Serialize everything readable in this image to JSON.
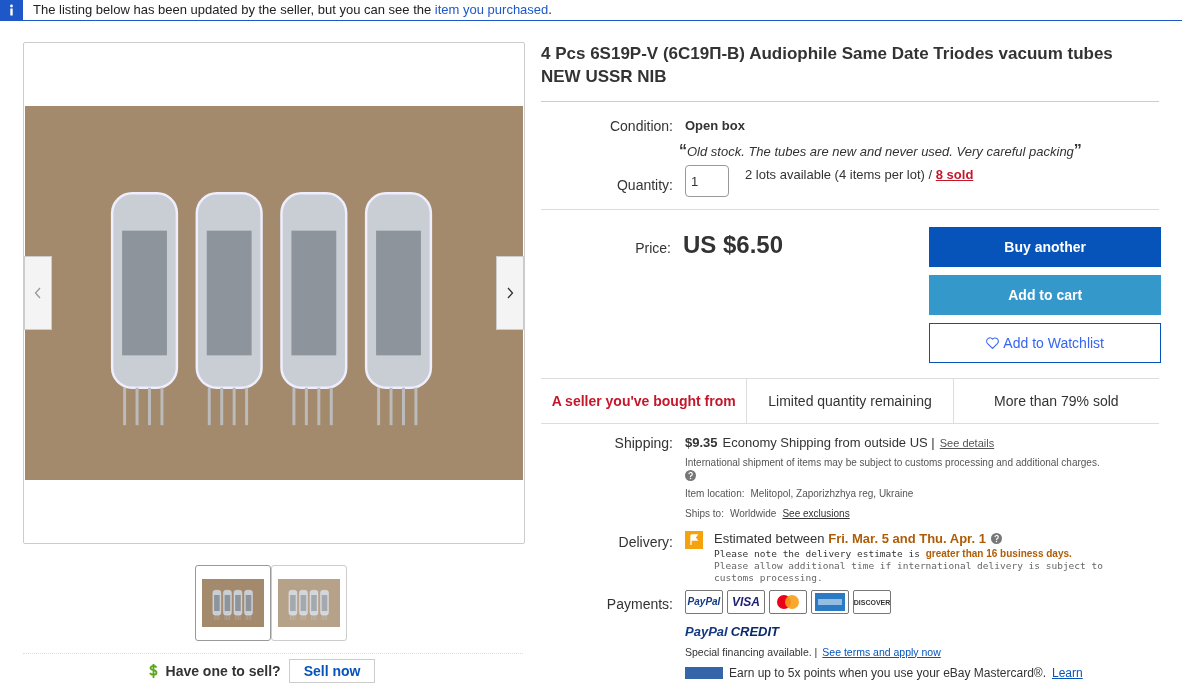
{
  "notice": {
    "text": "The listing below has been updated by the seller, but you can see the",
    "link": "item you purchased",
    "end": "."
  },
  "gallery": {
    "thumbnails": [
      {
        "selected": true
      },
      {
        "selected": false
      }
    ]
  },
  "sell": {
    "text": "Have one to sell?",
    "button": "Sell now"
  },
  "title": "4 Pcs 6S19P-V (6С19П-В) Audiophile Same Date Triodes vacuum tubes NEW USSR NIB",
  "condition": {
    "label": "Condition:",
    "value": "Open box",
    "open_quote": "“",
    "note": "Old stock. The tubes are new and never used. Very careful packing",
    "close_quote": "”"
  },
  "quantity": {
    "label": "Quantity:",
    "value": "1",
    "available": "2 lots available (4 items per lot) /",
    "sold": "8 sold"
  },
  "price": {
    "label": "Price:",
    "value": "US $6.50"
  },
  "buttons": [
    {
      "kind": "primary",
      "label": "Buy another"
    },
    {
      "kind": "secondary",
      "label": "Add to cart"
    },
    {
      "kind": "watch",
      "label": "Add to Watchlist"
    }
  ],
  "highlights": [
    {
      "text": "A seller you've bought from",
      "alert": true
    },
    {
      "text": "Limited quantity remaining",
      "alert": false
    },
    {
      "text": "More than 79% sold",
      "alert": false
    }
  ],
  "shipping": {
    "label": "Shipping:",
    "cost": "$9.35",
    "method": "Economy Shipping from outside US |",
    "details": "See details",
    "note": "International shipment of items may be subject to customs processing and additional charges.",
    "location_label": "Item location:",
    "location": "Melitopol, Zaporizhzhya reg, Ukraine",
    "ships_label": "Ships to:",
    "ships": "Worldwide",
    "exclusions": "See exclusions"
  },
  "delivery": {
    "label": "Delivery:",
    "text": "Estimated between",
    "dates": "Fri. Mar. 5 and Thu. Apr. 1",
    "note": "Please note the delivery estimate is",
    "note_bold": "greater than 16 business days.",
    "note2": "Please allow additional time if international delivery is subject to customs processing."
  },
  "payments": {
    "label": "Payments:",
    "cards": [
      {
        "kind": "paypal",
        "label": "PayPal"
      },
      {
        "kind": "visa",
        "label": "VISA"
      },
      {
        "kind": "mastercard"
      },
      {
        "kind": "amex"
      },
      {
        "kind": "discover",
        "label": "DISCOVER"
      }
    ],
    "credit_a": "PayPal",
    "credit_b": "CREDIT",
    "financing": "Special financing available.  |",
    "terms": "See terms and apply now",
    "promo": "Earn up to 5x points when you use your eBay Mastercard®.",
    "learn": "Learn"
  }
}
